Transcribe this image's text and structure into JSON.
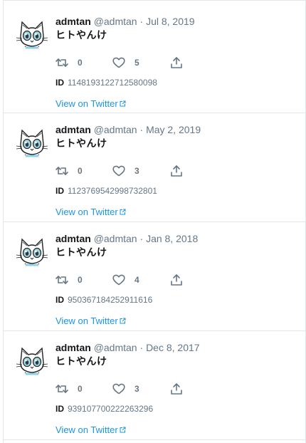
{
  "tweets": [
    {
      "name": "admtan",
      "handle": "@admtan",
      "separator": "·",
      "date": "Jul 8, 2019",
      "text": "ヒトやんけ",
      "retweets": "0",
      "likes": "5",
      "id_label": "ID",
      "id": "1148193122712580098",
      "link": "View on Twitter"
    },
    {
      "name": "admtan",
      "handle": "@admtan",
      "separator": "·",
      "date": "May 2, 2019",
      "text": "ヒトやんけ",
      "retweets": "0",
      "likes": "3",
      "id_label": "ID",
      "id": "1123769542998732801",
      "link": "View on Twitter"
    },
    {
      "name": "admtan",
      "handle": "@admtan",
      "separator": "·",
      "date": "Jan 8, 2018",
      "text": "ヒトやんけ",
      "retweets": "0",
      "likes": "4",
      "id_label": "ID",
      "id": "950367184252911616",
      "link": "View on Twitter"
    },
    {
      "name": "admtan",
      "handle": "@admtan",
      "separator": "·",
      "date": "Dec 8, 2017",
      "text": "ヒトやんけ",
      "retweets": "0",
      "likes": "3",
      "id_label": "ID",
      "id": "939107700222263296",
      "link": "View on Twitter"
    }
  ],
  "icons": {
    "avatar": "cat-avatar-icon",
    "retweet": "retweet-icon",
    "like": "heart-icon",
    "share": "share-icon",
    "external": "external-link-icon"
  },
  "colors": {
    "link": "#1b95e0",
    "muted": "#657786",
    "text": "#14171a",
    "border": "#e1e8ed"
  }
}
